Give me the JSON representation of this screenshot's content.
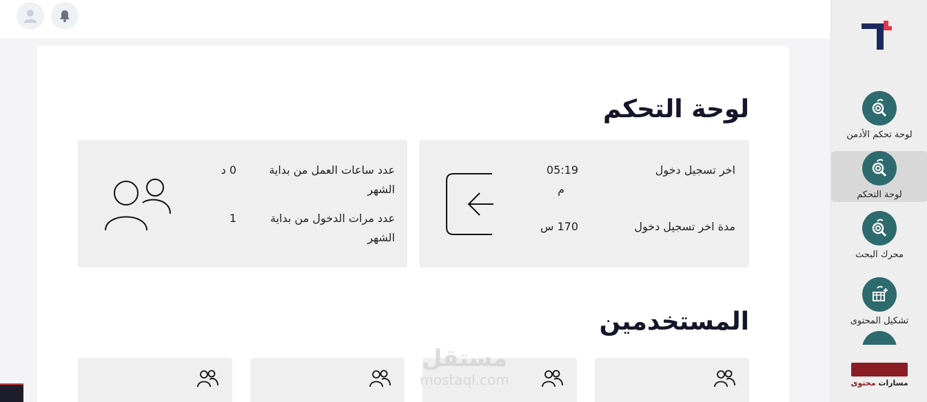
{
  "header": {
    "notification_icon": "bell-icon",
    "avatar_icon": "user-icon"
  },
  "sidebar": {
    "items": [
      {
        "label": "لوحة تحكم الأدمن",
        "icon": "admin-gear-search-icon",
        "active": false
      },
      {
        "label": "لوحة التحكم",
        "icon": "dashboard-gear-search-icon",
        "active": true
      },
      {
        "label": "محرك البحث",
        "icon": "search-engine-icon",
        "active": false
      },
      {
        "label": "تشكيل المحتوى",
        "icon": "content-builder-icon",
        "active": false
      }
    ],
    "brand": {
      "name_part1": "مسارات ",
      "name_part2": "محتوى"
    }
  },
  "main": {
    "title": "لوحة التحكم",
    "users_title": "المستخدمين",
    "login_card": {
      "last_login_label": "اخر تسجيل دخول",
      "last_login_value_line1": "05:19",
      "last_login_value_line2": "م",
      "last_duration_label": "مدة اخر تسجيل دخول",
      "last_duration_value": "170 س"
    },
    "work_card": {
      "hours_label_line1": "عدد ساعات العمل من بداية",
      "hours_label_line2": "الشهر",
      "hours_value": "0 د",
      "logins_label_line1": "عدد مرات الدخول من بداية",
      "logins_label_line2": "الشهر",
      "logins_value": "1"
    }
  },
  "watermark": {
    "arabic": "مستقل",
    "latin": "mostaql.com"
  },
  "colors": {
    "accent": "#2e6b6e",
    "brand": "#8a1c24",
    "logo_navy": "#1b2a5c",
    "logo_red": "#e8344a"
  }
}
